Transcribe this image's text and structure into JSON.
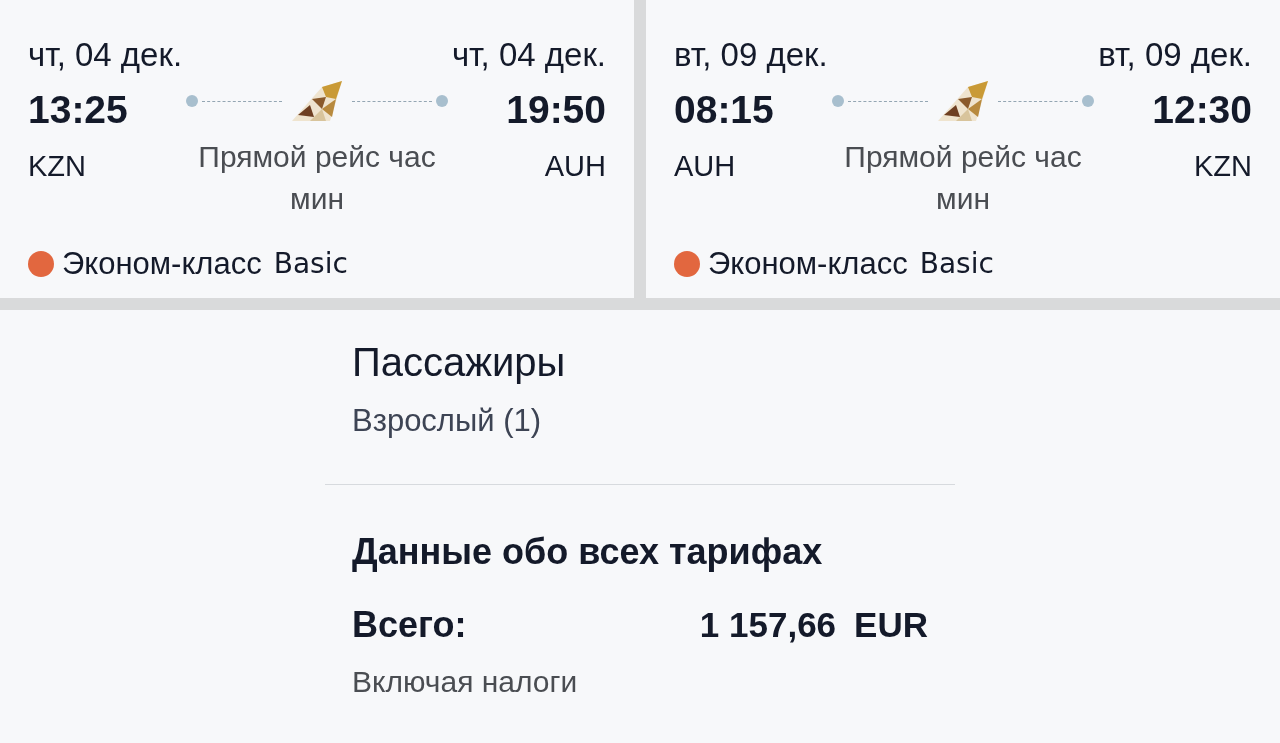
{
  "segments": [
    {
      "departure": {
        "date": "чт, 04 дек.",
        "time": "13:25",
        "airport": "KZN"
      },
      "arrival": {
        "date": "чт, 04 дек.",
        "time": "19:50",
        "airport": "AUH"
      },
      "route_type": "Прямой рейс час мин",
      "cabin": {
        "class": "Эконом-класс",
        "fare": "Basic",
        "color": "#e2673f"
      }
    },
    {
      "departure": {
        "date": "вт, 09 дек.",
        "time": "08:15",
        "airport": "AUH"
      },
      "arrival": {
        "date": "вт, 09 дек.",
        "time": "12:30",
        "airport": "KZN"
      },
      "route_type": "Прямой рейс час мин",
      "cabin": {
        "class": "Эконом-класс",
        "fare": "Basic",
        "color": "#e2673f"
      }
    }
  ],
  "passengers": {
    "title": "Пассажиры",
    "items": [
      "Взрослый (1)"
    ]
  },
  "fares": {
    "title": "Данные обо всех тарифах",
    "total_label": "Всего:",
    "total_amount": "1 157,66",
    "currency": "EUR",
    "note": "Включая налоги"
  }
}
